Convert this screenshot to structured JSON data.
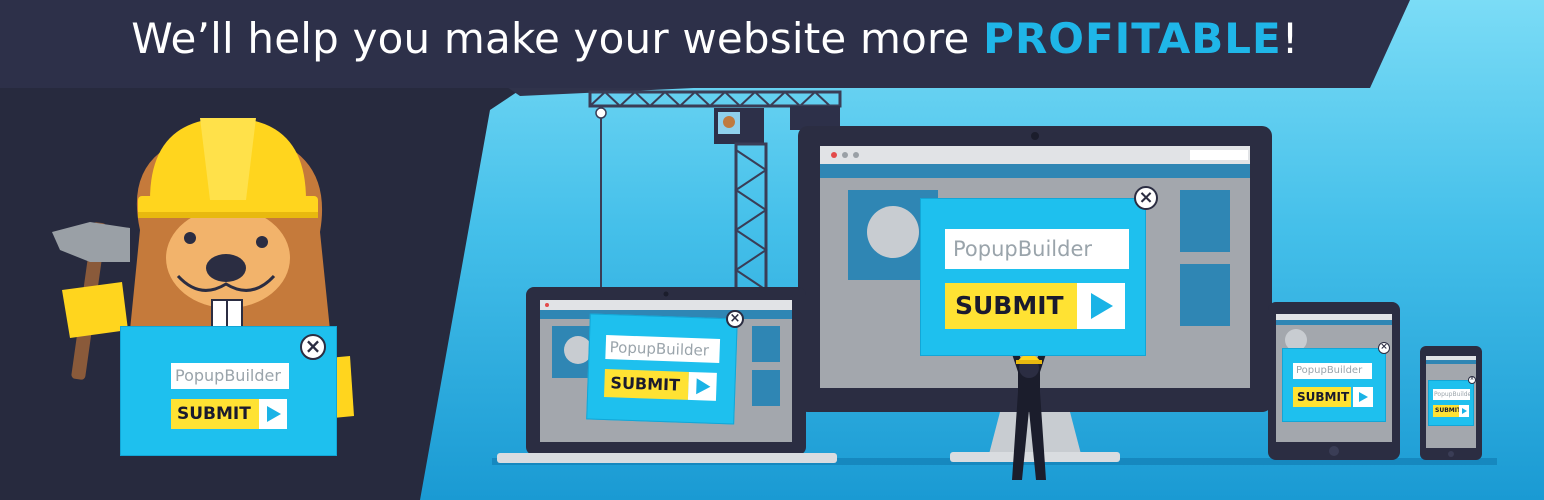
{
  "headline": {
    "prefix": "We’ll help you make your website more ",
    "emphasis": "PROFITABLE",
    "suffix": "!"
  },
  "popup": {
    "brand": "PopupBuilder",
    "submit_label": "SUBMIT",
    "close_symbol": "×"
  },
  "colors": {
    "dark_navy": "#2b2d42",
    "popup_blue": "#1ec0ee",
    "submit_yellow": "#ffe233",
    "accent": "#1fb6e8"
  },
  "icons": [
    "close-icon",
    "play-arrow-icon",
    "crane-icon",
    "hammer-icon",
    "hard-hat-icon"
  ]
}
